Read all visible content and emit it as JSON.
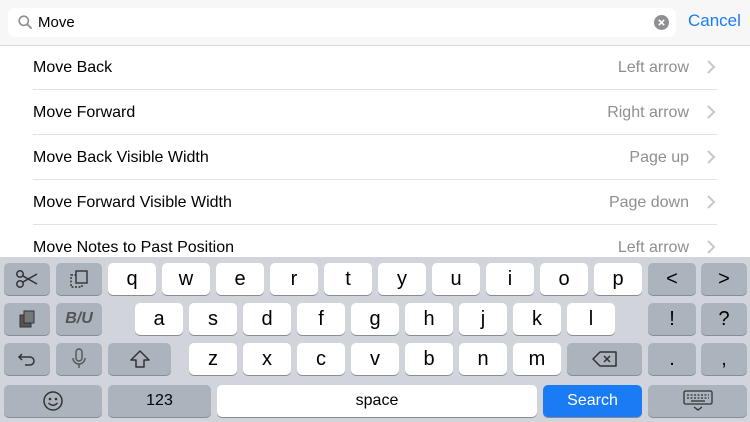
{
  "search": {
    "value": "Move",
    "cancel_label": "Cancel"
  },
  "results": [
    {
      "title": "Move Back",
      "shortcut": "Left arrow"
    },
    {
      "title": "Move Forward",
      "shortcut": "Right arrow"
    },
    {
      "title": "Move Back Visible Width",
      "shortcut": "Page up"
    },
    {
      "title": "Move Forward Visible Width",
      "shortcut": "Page down"
    },
    {
      "title": "Move Notes to Past Position",
      "shortcut": "Left arrow"
    }
  ],
  "keyboard": {
    "row1": [
      "q",
      "w",
      "e",
      "r",
      "t",
      "y",
      "u",
      "i",
      "o",
      "p"
    ],
    "row2": [
      "a",
      "s",
      "d",
      "f",
      "g",
      "h",
      "j",
      "k",
      "l"
    ],
    "row3": [
      "z",
      "x",
      "c",
      "v",
      "b",
      "n",
      "m"
    ],
    "left_arrow": "<",
    "right_arrow": ">",
    "exclaim": "!",
    "question": "?",
    "period": ".",
    "comma": ",",
    "biu_label": "B/U",
    "numbers_label": "123",
    "space_label": "space",
    "search_label": "Search"
  },
  "colors": {
    "accent": "#1a7cf5",
    "keyboard_bg": "#d1d5db",
    "dark_key": "#abb3bd"
  }
}
